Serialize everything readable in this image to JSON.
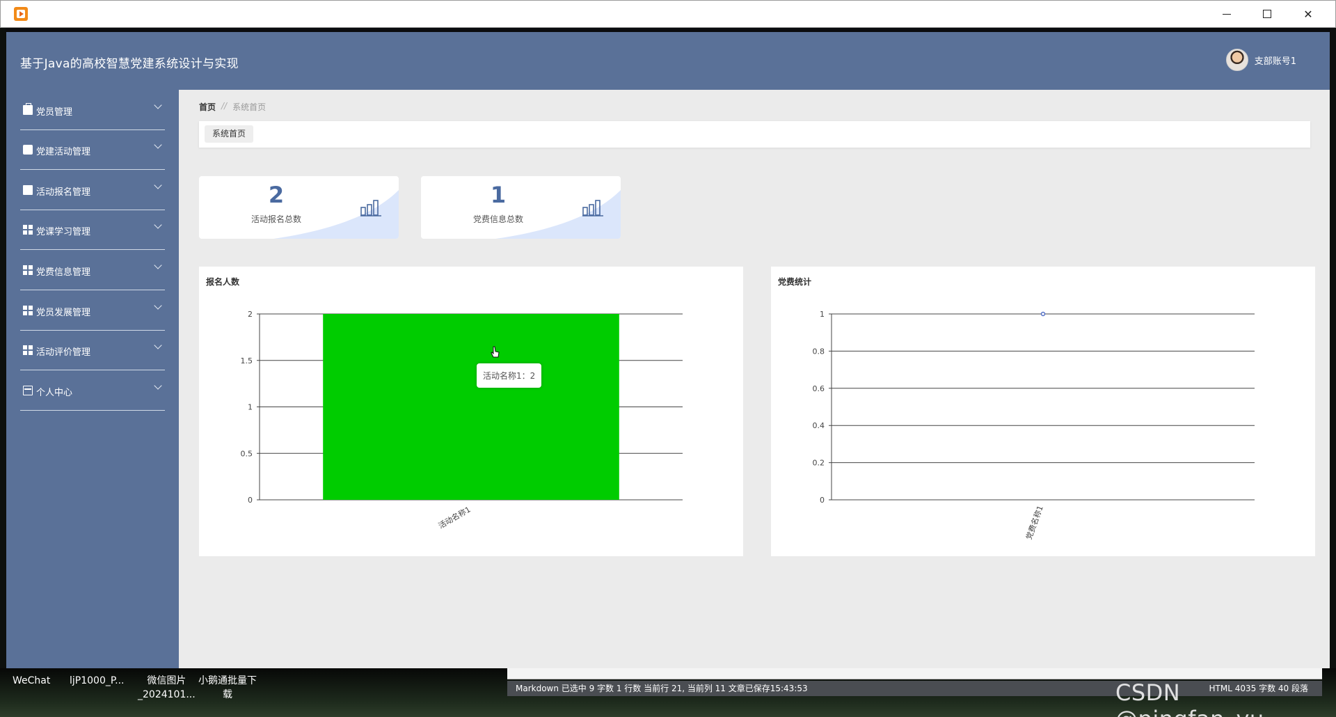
{
  "app": {
    "title": "基于Java的高校智慧党建系统设计与实现",
    "user_name": "支部账号1"
  },
  "window": {
    "minimize_glyph": "—",
    "close_glyph": "✕"
  },
  "sidebar": {
    "items": [
      {
        "label": "党员管理",
        "icon": "briefcase-icon"
      },
      {
        "label": "党建活动管理",
        "icon": "box-icon"
      },
      {
        "label": "活动报名管理",
        "icon": "clipboard-icon"
      },
      {
        "label": "党课学习管理",
        "icon": "grid-icon"
      },
      {
        "label": "党费信息管理",
        "icon": "grid-icon"
      },
      {
        "label": "党员发展管理",
        "icon": "grid-icon"
      },
      {
        "label": "活动评价管理",
        "icon": "grid-icon"
      },
      {
        "label": "个人中心",
        "icon": "card-icon"
      }
    ]
  },
  "breadcrumb": {
    "home": "首页",
    "separator": "//",
    "current": "系统首页"
  },
  "tabs": [
    {
      "label": "系统首页"
    }
  ],
  "stats": [
    {
      "value": "2",
      "label": "活动报名总数"
    },
    {
      "value": "1",
      "label": "党费信息总数"
    }
  ],
  "chart_data": [
    {
      "type": "bar",
      "title": "报名人数",
      "categories": [
        "活动名称1"
      ],
      "values": [
        2
      ],
      "ylim": [
        0,
        2
      ],
      "yticks": [
        "0",
        "0.5",
        "1",
        "1.5",
        "2"
      ],
      "color": "#00cc00",
      "grid": true,
      "tooltip": "活动名称1：2"
    },
    {
      "type": "line",
      "title": "党费统计",
      "categories": [
        "党费名称1"
      ],
      "values": [
        1
      ],
      "ylim": [
        0,
        1
      ],
      "yticks": [
        "0",
        "0.2",
        "0.4",
        "0.6",
        "0.8",
        "1"
      ],
      "color": "#5470c6",
      "grid": true
    }
  ],
  "taskbar": {
    "items": [
      "WeChat",
      "ljP1000_P...",
      "微信图片\n_2024101...",
      "小鹅通批量下\n载"
    ]
  },
  "editor_status": {
    "left": "Markdown 已选中  9 字数  1 行数  当前行 21, 当前列 11  文章已保存15:43:53",
    "right": "HTML  4035 字数  40 段落"
  },
  "watermark": "CSDN @pingfan_yu"
}
